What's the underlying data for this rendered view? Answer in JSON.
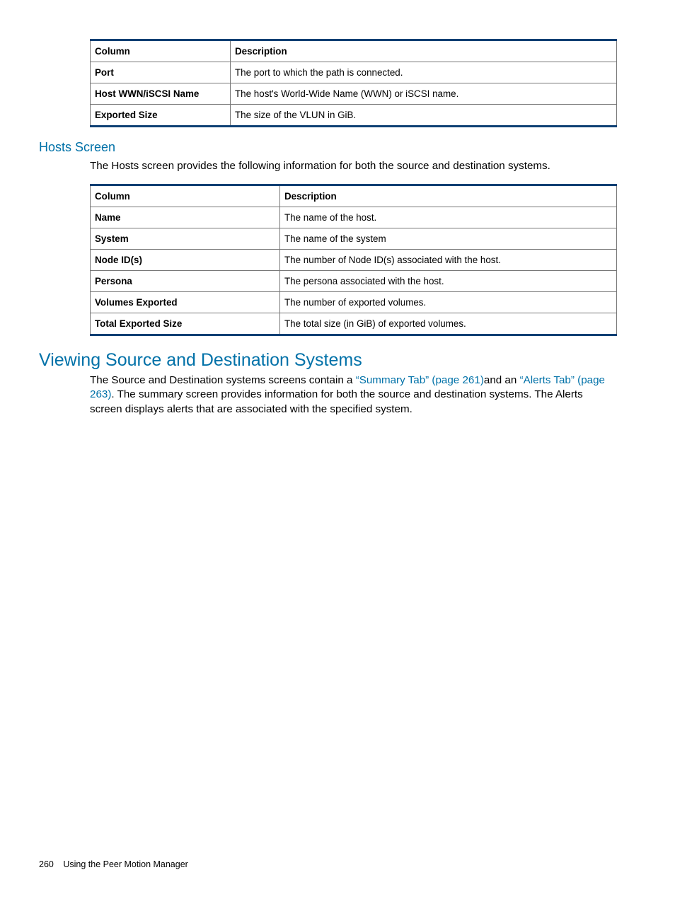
{
  "table1": {
    "headers": [
      "Column",
      "Description"
    ],
    "rows": [
      [
        "Port",
        "The port to which the path is connected."
      ],
      [
        "Host WWN/iSCSI Name",
        "The host's World-Wide Name (WWN) or iSCSI name."
      ],
      [
        "Exported Size",
        "The size of the VLUN in GiB."
      ]
    ]
  },
  "hosts_screen": {
    "title": "Hosts Screen",
    "intro": "The Hosts screen provides the following information for both the source and destination systems."
  },
  "table2": {
    "headers": [
      "Column",
      "Description"
    ],
    "rows": [
      [
        "Name",
        "The name of the host."
      ],
      [
        "System",
        "The name of the system"
      ],
      [
        "Node ID(s)",
        "The number of Node ID(s) associated with the host."
      ],
      [
        "Persona",
        "The persona associated with the host."
      ],
      [
        "Volumes Exported",
        "The number of exported volumes."
      ],
      [
        "Total Exported Size",
        "The total size (in GiB) of exported volumes."
      ]
    ]
  },
  "viewing": {
    "title": "Viewing Source and Destination Systems",
    "para_pre": "The Source and Destination systems screens contain a ",
    "link1": "“Summary Tab” (page 261)",
    "para_mid": "and an ",
    "link2": "“Alerts Tab” (page 263)",
    "para_post": ". The summary screen provides information for both the source and destination systems. The Alerts screen displays alerts that are associated with the specified system."
  },
  "footer": {
    "page_number": "260",
    "section": "Using the Peer Motion Manager"
  }
}
